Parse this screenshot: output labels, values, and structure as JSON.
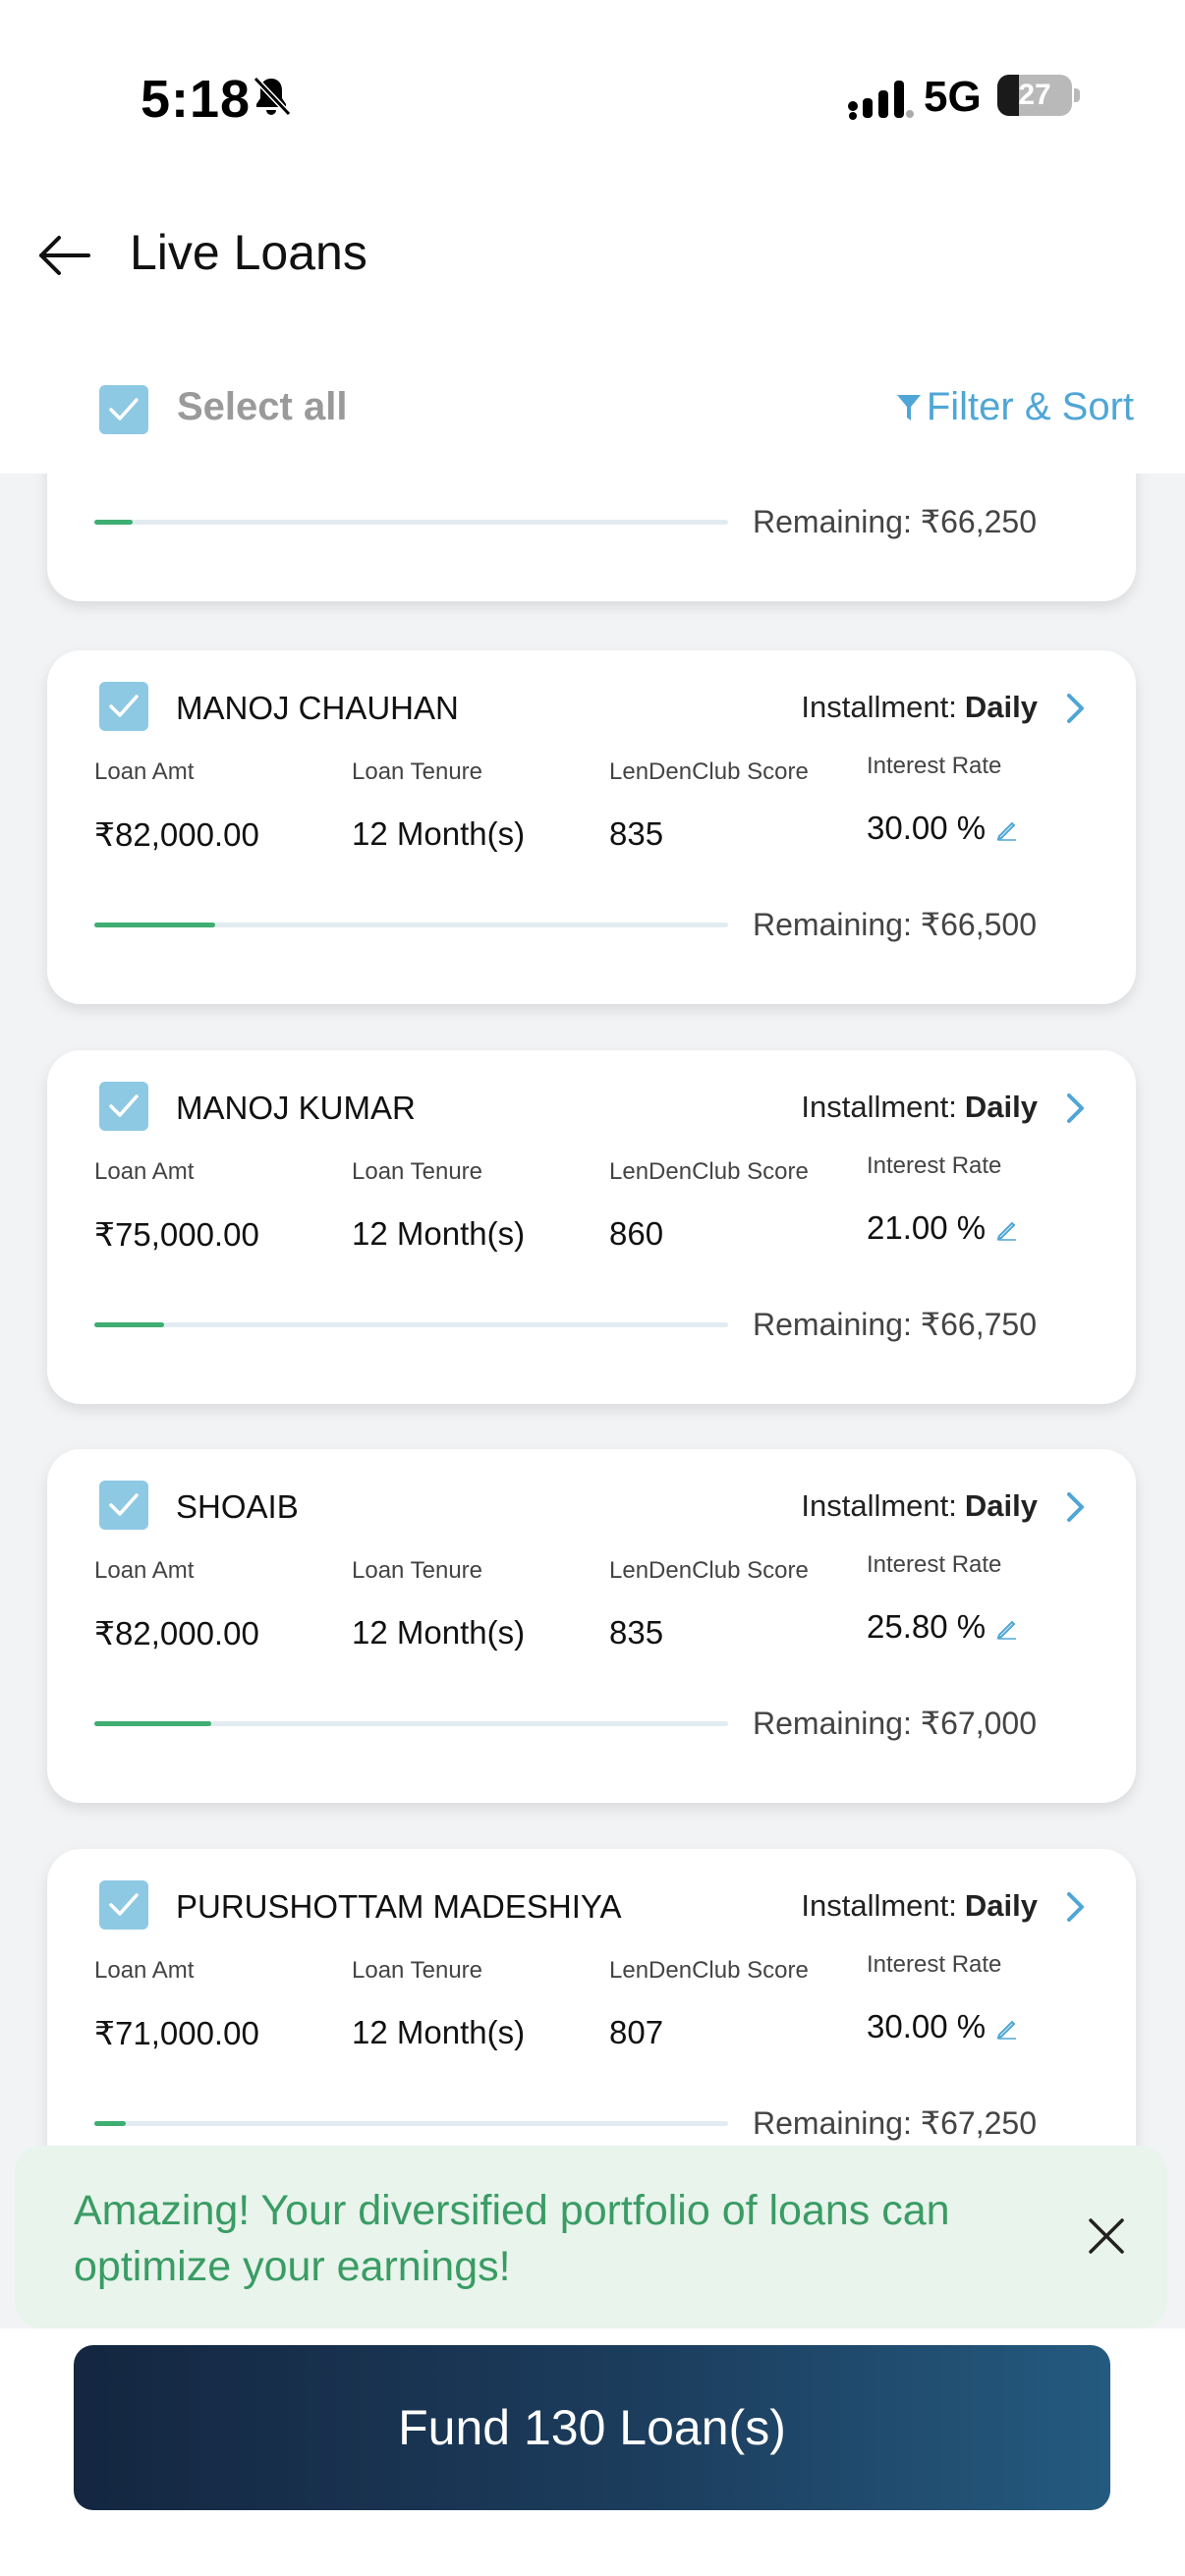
{
  "status_bar": {
    "time": "5:18",
    "network": "5G",
    "battery": "27"
  },
  "header": {
    "title": "Live Loans"
  },
  "select_bar": {
    "select_all_label": "Select all",
    "filter_sort_label": "Filter & Sort"
  },
  "labels": {
    "installment": "Installment:",
    "loan_amt": "Loan Amt",
    "loan_tenure": "Loan Tenure",
    "score": "LenDenClub Score",
    "interest_rate": "Interest Rate"
  },
  "loans": [
    {
      "name": "",
      "installment": "",
      "amount": "",
      "tenure": "",
      "score": "",
      "rate": "",
      "remaining": "Remaining: ₹66,250",
      "progress": 0.06,
      "selected": true
    },
    {
      "name": "MANOJ CHAUHAN",
      "installment": "Daily",
      "amount": "₹82,000.00",
      "tenure": "12 Month(s)",
      "score": "835",
      "rate": "30.00 %",
      "remaining": "Remaining: ₹66,500",
      "progress": 0.19,
      "selected": true
    },
    {
      "name": "MANOJ KUMAR",
      "installment": "Daily",
      "amount": "₹75,000.00",
      "tenure": "12 Month(s)",
      "score": "860",
      "rate": "21.00 %",
      "remaining": "Remaining: ₹66,750",
      "progress": 0.11,
      "selected": true
    },
    {
      "name": "SHOAIB",
      "installment": "Daily",
      "amount": "₹82,000.00",
      "tenure": "12 Month(s)",
      "score": "835",
      "rate": "25.80 %",
      "remaining": "Remaining: ₹67,000",
      "progress": 0.185,
      "selected": true
    },
    {
      "name": "PURUSHOTTAM MADESHIYA",
      "installment": "Daily",
      "amount": "₹71,000.00",
      "tenure": "12 Month(s)",
      "score": "807",
      "rate": "30.00 %",
      "remaining": "Remaining: ₹67,250",
      "progress": 0.05,
      "selected": true
    }
  ],
  "toast": {
    "message": "Amazing! Your diversified portfolio of loans can optimize your earnings!"
  },
  "fund_button": {
    "label": "Fund 130 Loan(s)"
  },
  "colors": {
    "accent_blue": "#4fa6d6",
    "checkbox": "#8ec9e3",
    "progress": "#3fae72",
    "toast_text": "#3a9c64",
    "button_dark": "#142640"
  }
}
